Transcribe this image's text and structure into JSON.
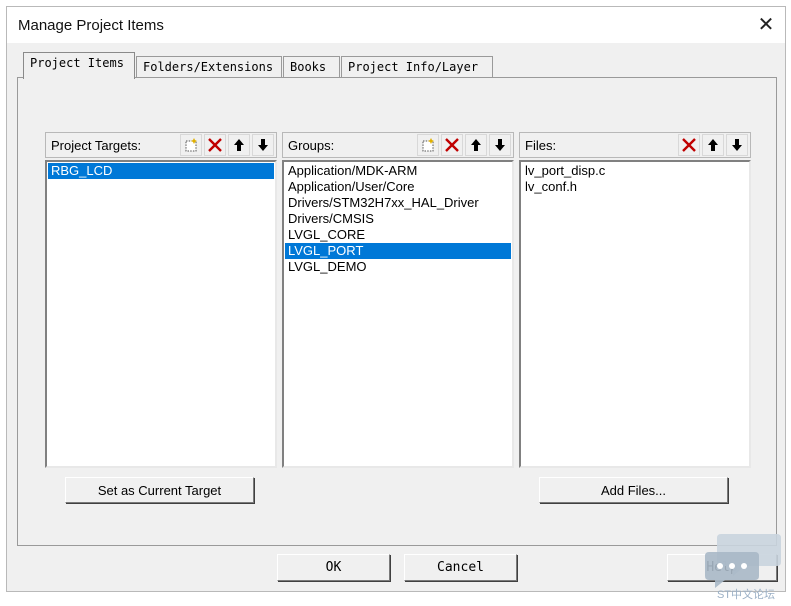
{
  "window": {
    "title": "Manage Project Items"
  },
  "tabs": [
    "Project Items",
    "Folders/Extensions",
    "Books",
    "Project Info/Layer"
  ],
  "targets": {
    "label": "Project Targets:",
    "items": [
      "RBG_LCD"
    ]
  },
  "groups": {
    "label": "Groups:",
    "items": [
      "Application/MDK-ARM",
      "Application/User/Core",
      "Drivers/STM32H7xx_HAL_Driver",
      "Drivers/CMSIS",
      "LVGL_CORE",
      "LVGL_PORT",
      "LVGL_DEMO"
    ]
  },
  "files": {
    "label": "Files:",
    "items": [
      "lv_port_disp.c",
      "lv_conf.h"
    ]
  },
  "buttons": {
    "set_current": "Set as Current Target",
    "add_files": "Add Files...",
    "ok": "OK",
    "cancel": "Cancel",
    "help": "Help"
  },
  "watermark": {
    "text": "ST中文论坛"
  },
  "icons": {
    "new": "new-item-icon",
    "delete": "delete-icon",
    "up": "arrow-up-icon",
    "down": "arrow-down-icon"
  },
  "colors": {
    "selection": "#0078d7",
    "delete_red": "#c00000"
  }
}
